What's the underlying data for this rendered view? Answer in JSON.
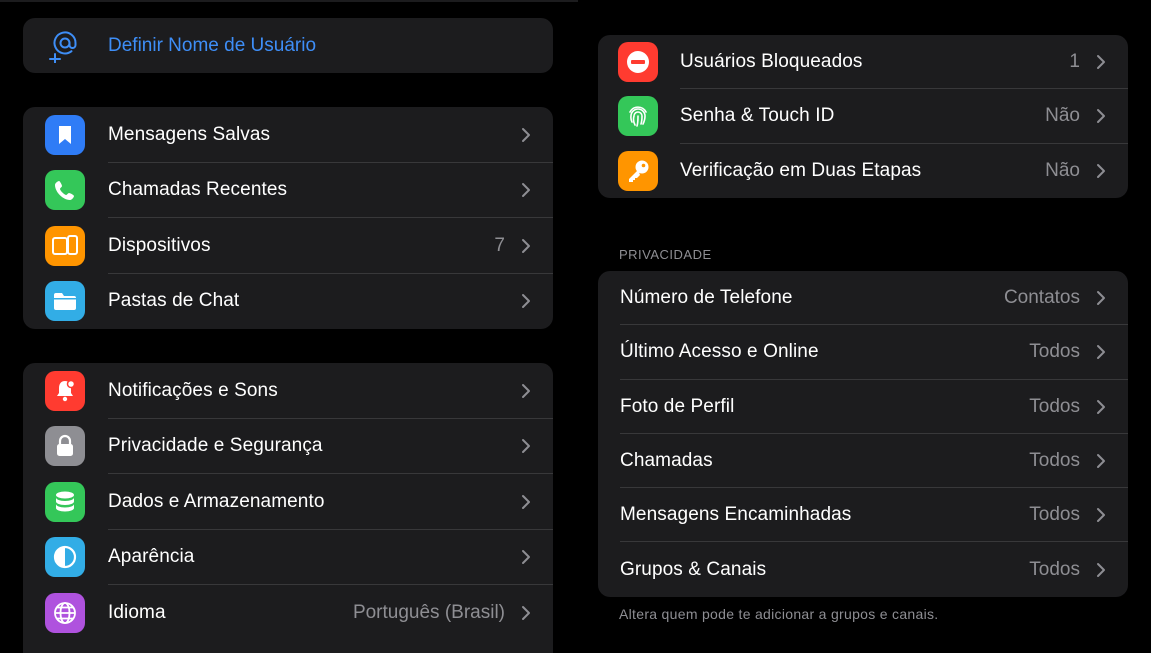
{
  "username_card": {
    "label": "Definir Nome de Usuário",
    "icon": "at-person-icon",
    "accent": "#3e8ef7"
  },
  "group1": [
    {
      "label": "Mensagens Salvas",
      "value": "",
      "icon": "bookmark-icon",
      "color": "#2f7cf6"
    },
    {
      "label": "Chamadas Recentes",
      "value": "",
      "icon": "phone-icon",
      "color": "#34c759"
    },
    {
      "label": "Dispositivos",
      "value": "7",
      "icon": "devices-icon",
      "color": "#ff9500"
    },
    {
      "label": "Pastas de Chat",
      "value": "",
      "icon": "folder-icon",
      "color": "#32ade6"
    }
  ],
  "group2": [
    {
      "label": "Notificações e Sons",
      "value": "",
      "icon": "bell-icon",
      "color": "#ff3b30"
    },
    {
      "label": "Privacidade e Segurança",
      "value": "",
      "icon": "lock-icon",
      "color": "#8e8e93"
    },
    {
      "label": "Dados e Armazenamento",
      "value": "",
      "icon": "database-icon",
      "color": "#34c759"
    },
    {
      "label": "Aparência",
      "value": "",
      "icon": "contrast-icon",
      "color": "#32ade6"
    },
    {
      "label": "Idioma",
      "value": "Português (Brasil)",
      "icon": "globe-icon",
      "color": "#af52de"
    }
  ],
  "security": [
    {
      "label": "Usuários Bloqueados",
      "value": "1",
      "icon": "block-icon",
      "color": "#ff3b30"
    },
    {
      "label": "Senha & Touch ID",
      "value": "Não",
      "icon": "fingerprint-icon",
      "color": "#34c759"
    },
    {
      "label": "Verificação em Duas Etapas",
      "value": "Não",
      "icon": "key-icon",
      "color": "#ff9500"
    }
  ],
  "privacy": {
    "header": "PRIVACIDADE",
    "items": [
      {
        "label": "Número de Telefone",
        "value": "Contatos"
      },
      {
        "label": "Último Acesso e Online",
        "value": "Todos"
      },
      {
        "label": "Foto de Perfil",
        "value": "Todos"
      },
      {
        "label": "Chamadas",
        "value": "Todos"
      },
      {
        "label": "Mensagens Encaminhadas",
        "value": "Todos"
      },
      {
        "label": "Grupos & Canais",
        "value": "Todos"
      }
    ],
    "footer": "Altera quem pode te adicionar a grupos e canais."
  }
}
